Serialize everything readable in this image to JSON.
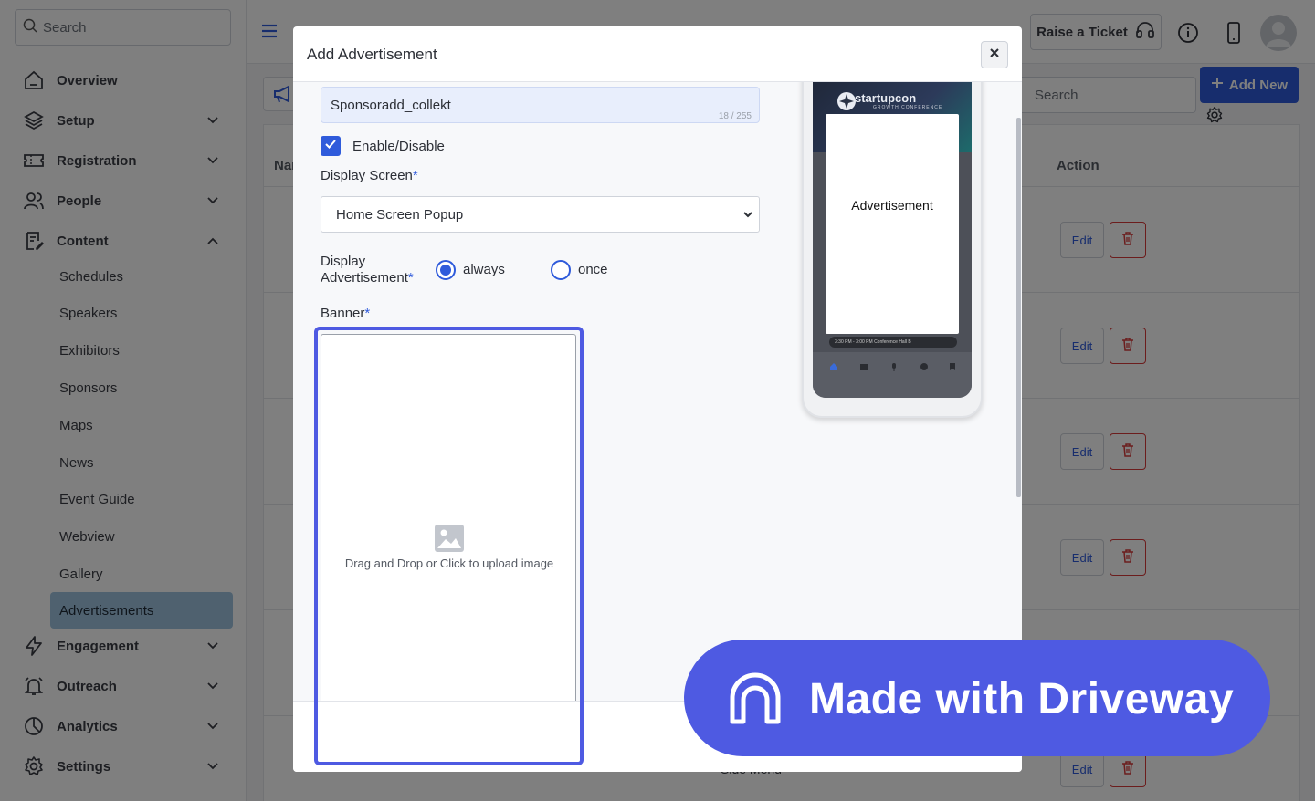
{
  "sidebar": {
    "search_placeholder": "Search",
    "nav": [
      {
        "label": "Overview"
      },
      {
        "label": "Setup"
      },
      {
        "label": "Registration"
      },
      {
        "label": "People"
      },
      {
        "label": "Content"
      },
      {
        "label": "Engagement"
      },
      {
        "label": "Outreach"
      },
      {
        "label": "Analytics"
      },
      {
        "label": "Settings"
      }
    ],
    "content_items": [
      "Schedules",
      "Speakers",
      "Exhibitors",
      "Sponsors",
      "Maps",
      "News",
      "Event Guide",
      "Webview",
      "Gallery",
      "Advertisements"
    ],
    "active_item": "Advertisements"
  },
  "topbar": {
    "raise_ticket": "Raise a Ticket"
  },
  "main": {
    "search_placeholder": "Search",
    "add_new": "Add New",
    "columns": {
      "name": "Nar",
      "action": "Action"
    },
    "edit_label": "Edit",
    "bottom_cell": "Side Menu"
  },
  "modal": {
    "title": "Add Advertisement",
    "name_value": "Sponsoradd_collekt",
    "char_count": "18 / 255",
    "enable_label": "Enable/Disable",
    "enabled": true,
    "display_screen_label": "Display Screen",
    "display_screen_value": "Home Screen Popup",
    "display_ad_label_1": "Display",
    "display_ad_label_2": "Advertisement",
    "radio_always": "always",
    "radio_once": "once",
    "radio_selected": "always",
    "banner_label": "Banner",
    "upload_text": "Drag and Drop or Click to upload image",
    "preview": {
      "brand": "startupcon",
      "tagline": "GROWTH CONFERENCE",
      "ad_text": "Advertisement",
      "strip_text": "3:30 PM - 3:00 PM   Conference Hall B"
    }
  },
  "badge": {
    "text": "Made with Driveway"
  },
  "colors": {
    "accent": "#2f5bdb",
    "active_nav": "#9ec3df",
    "badge": "#4e5ae2",
    "delete": "#d83b3b"
  }
}
